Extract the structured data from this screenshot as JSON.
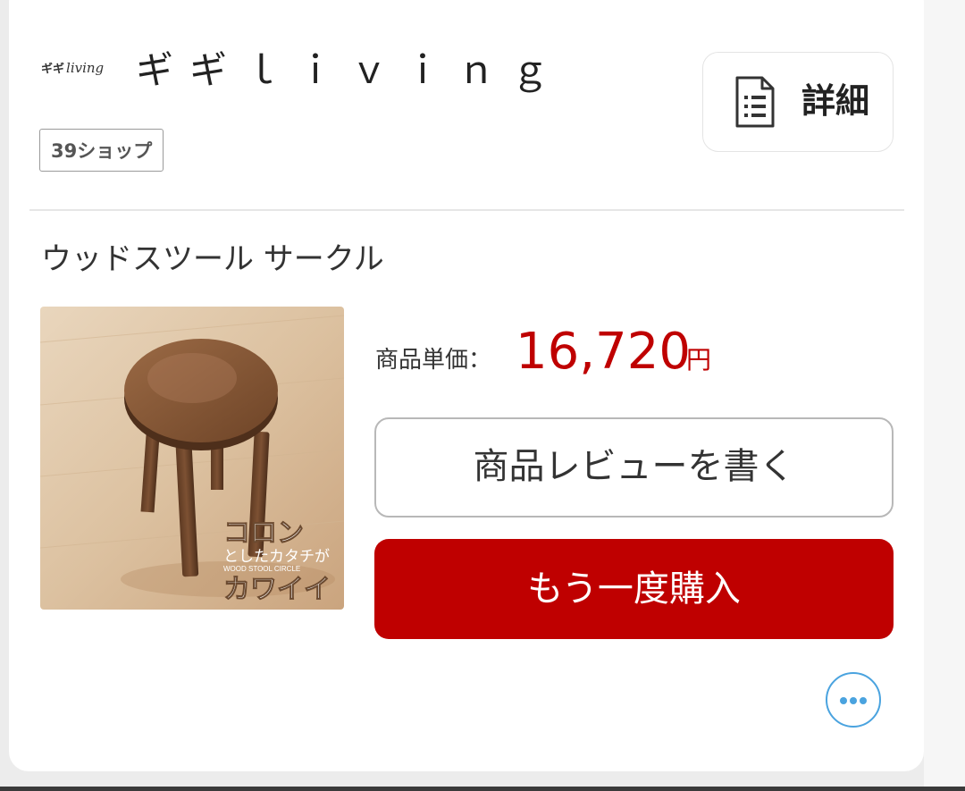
{
  "shop": {
    "logo_kana": "ギギ",
    "logo_script": "living",
    "name": "ギギｌｉｖｉｎｇ",
    "badge": "39ショップ",
    "detail_label": "詳細"
  },
  "product": {
    "title": "ウッドスツール サークル",
    "image_caption_main": "コロン",
    "image_caption_sub": "としたカタチが",
    "image_caption_en": "WOOD STOOL CIRCLE",
    "image_caption_bottom": "カワイイ",
    "price_label": "商品単価：",
    "price_value": "16,720",
    "price_unit": "円"
  },
  "actions": {
    "review_label": "商品レビューを書く",
    "rebuy_label": "もう一度購入"
  },
  "icons": {
    "detail": "document-list-icon",
    "more": "more-horizontal-icon"
  },
  "colors": {
    "accent": "#bf0000",
    "more_icon": "#4aa3df"
  }
}
